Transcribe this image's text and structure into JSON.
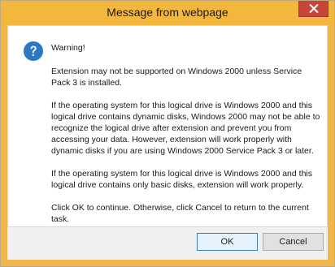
{
  "window": {
    "title": "Message from webpage"
  },
  "dialog": {
    "icon": "question-icon",
    "paragraphs": [
      "Warning!",
      "Extension may not be supported on Windows 2000 unless Service Pack 3 is installed.",
      "If the operating system for this logical drive is Windows 2000 and this logical drive contains dynamic disks, Windows 2000 may not be able to recognize the logical drive after extension and prevent you from accessing your data. However, extension will work properly with dynamic disks if you are using Windows 2000 Service Pack 3 or later.",
      "If the operating system for this logical drive is Windows 2000 and this logical drive contains only basic disks, extension will work properly.",
      "Click OK to continue. Otherwise, click Cancel to return to the current task."
    ]
  },
  "buttons": {
    "ok_label": "OK",
    "cancel_label": "Cancel"
  },
  "colors": {
    "titlebar": "#f4b73e",
    "close_button": "#c7463b",
    "icon": "#2b78c5"
  }
}
